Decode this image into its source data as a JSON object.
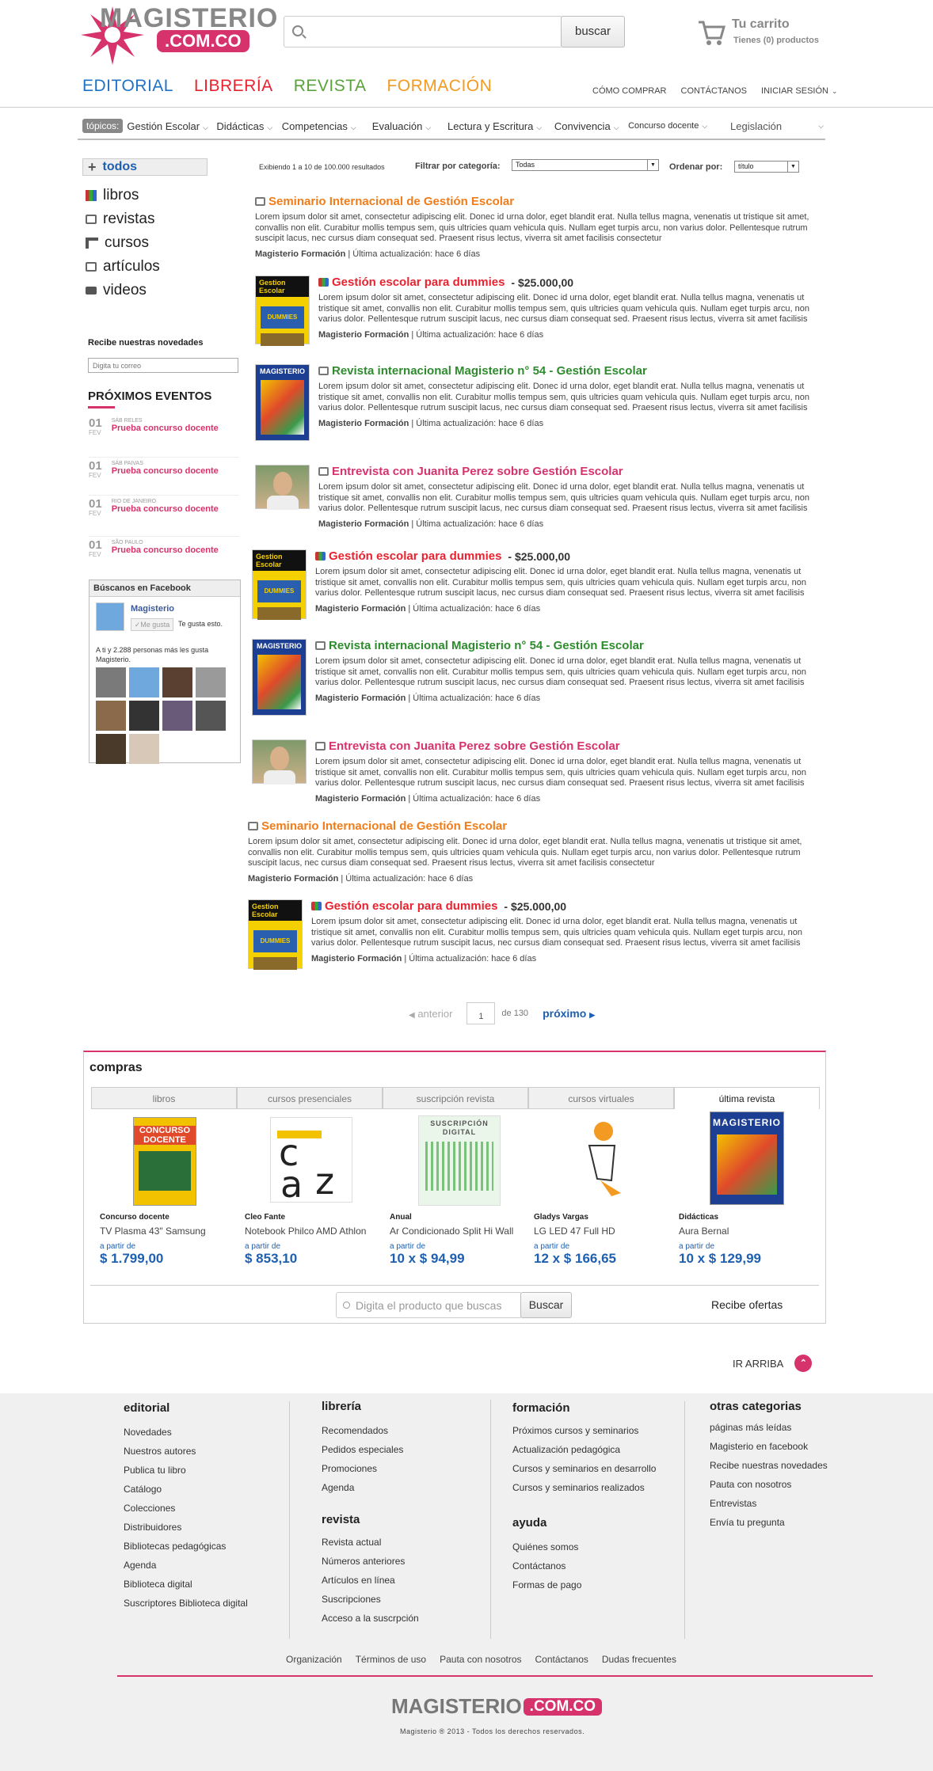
{
  "header": {
    "logo_word": "MAGISTERIO",
    "logo_suffix": ".COM.CO",
    "search_button": "buscar",
    "cart_title": "Tu carrito",
    "cart_sub": "Tienes (0) productos"
  },
  "main_nav": [
    "EDITORIAL",
    "LIBRERÍA",
    "REVISTA",
    "FORMACIÓN"
  ],
  "top_links": [
    "CÓMO COMPRAR",
    "CONTÁCTANOS",
    "INICIAR SESIÓN"
  ],
  "topics": {
    "label": "tópicos:",
    "items": [
      "Gestión Escolar",
      "Didácticas",
      "Competencias",
      "Evaluación",
      "Lectura y Escritura",
      "Convivencia",
      "Concurso docente",
      "Legislación"
    ]
  },
  "sidebar": {
    "all_label": "todos",
    "categories": [
      "libros",
      "revistas",
      "cursos",
      "artículos",
      "videos"
    ],
    "newsletter_title": "Recibe nuestras novedades",
    "newsletter_placeholder": "Digita tu correo",
    "events_title": "PRÓXIMOS EVENTOS",
    "events": [
      {
        "day": "01",
        "mon": "FEV",
        "sub": "SÁB RELES",
        "title": "Prueba concurso docente"
      },
      {
        "day": "01",
        "mon": "FEV",
        "sub": "SÁB PAIVAS",
        "title": "Prueba concurso docente"
      },
      {
        "day": "01",
        "mon": "FEV",
        "sub": "RIO DE JANEIRO",
        "title": "Prueba concurso docente"
      },
      {
        "day": "01",
        "mon": "FEV",
        "sub": "SÃO PAULO",
        "title": "Prueba concurso docente"
      }
    ],
    "fb_title": "Búscanos en Facebook",
    "fb_page": "Magisterio",
    "fb_like": "Me gusta",
    "fb_like_text": "Te gusta esto.",
    "fb_count": "A ti y 2.288 personas más les gusta Magisterio."
  },
  "results": {
    "summary": "Exibiendo 1 a 10 de 100.000 resultados",
    "filter_label": "Filtrar por categoría:",
    "filter_value": "Todas",
    "order_label": "Ordenar por:",
    "order_value": "título",
    "lorem": "Lorem ipsum dolor sit amet, consectetur adipiscing elit. Donec id urna dolor, eget blandit erat. Nulla tellus magna, venenatis ut tristique sit amet, convallis non elit. Curabitur mollis tempus sem, quis ultricies quam vehicula quis. Nullam eget turpis arcu, non varius dolor. Pellentesque rutrum suscipit lacus, nec cursus diam consequat sed. Praesent risus lectus, viverra sit amet facilisis consectetur",
    "meta_author": "Magisterio Formación",
    "meta_rest": "| Última actualización: hace 6 días",
    "items": [
      {
        "title": "Seminario Internacional de Gestión Escolar",
        "color": "#f07d1a",
        "price": "",
        "thumb": "none"
      },
      {
        "title": "Gestión escolar para dummies",
        "color": "#e8222f",
        "price": "- $25.000,00",
        "thumb": "dummies"
      },
      {
        "title": "Revista internacional Magisterio n° 54 - Gestión Escolar",
        "color": "#2e8b2e",
        "price": "",
        "thumb": "magazine"
      },
      {
        "title": "Entrevista con Juanita Perez sobre Gestión Escolar",
        "color": "#d6336c",
        "price": "",
        "thumb": "photo"
      },
      {
        "title": "Gestión escolar para dummies",
        "color": "#e8222f",
        "price": "- $25.000,00",
        "thumb": "dummies"
      },
      {
        "title": "Revista internacional Magisterio n° 54 - Gestión Escolar",
        "color": "#2e8b2e",
        "price": "",
        "thumb": "magazine"
      },
      {
        "title": "Entrevista con Juanita Perez sobre Gestión Escolar",
        "color": "#d6336c",
        "price": "",
        "thumb": "photo"
      },
      {
        "title": "Seminario Internacional de Gestión Escolar",
        "color": "#f07d1a",
        "price": "",
        "thumb": "none"
      },
      {
        "title": "Gestión escolar para dummies",
        "color": "#e8222f",
        "price": "- $25.000,00",
        "thumb": "dummies"
      }
    ]
  },
  "pagination": {
    "prev": "anterior",
    "page": "1",
    "of": "de 130",
    "next": "próximo"
  },
  "compras": {
    "title": "compras",
    "tabs": [
      "libros",
      "cursos presenciales",
      "suscripción revista",
      "cursos virtuales",
      "última revista"
    ],
    "products": [
      {
        "cat": "Concurso docente",
        "name": "TV Plasma 43\" Samsung",
        "apartir": "a partir de",
        "price": "$ 1.799,00"
      },
      {
        "cat": "Cleo Fante",
        "name": "Notebook Philco AMD Athlon",
        "apartir": "a partir de",
        "price": "$ 853,10"
      },
      {
        "cat": "Anual",
        "name": "Ar Condicionado Split Hi Wall",
        "apartir": "a partir de",
        "price": "10 x $ 94,99"
      },
      {
        "cat": "Gladys Vargas",
        "name": "LG LED 47 Full HD",
        "apartir": "a partir de",
        "price": "12 x $ 166,65"
      },
      {
        "cat": "Didácticas",
        "name": "Aura Bernal",
        "apartir": "a partir de",
        "price": "10 x $ 129,99"
      }
    ],
    "search_placeholder": "Digita el producto que buscas",
    "search_button": "Buscar",
    "offers": "Recibe ofertas"
  },
  "back_to_top": "IR ARRIBA",
  "footer": {
    "cols": [
      {
        "title": "editorial",
        "links": [
          "Novedades",
          "Nuestros autores",
          "Publica tu libro",
          "Catálogo",
          "Colecciones",
          "Distribuidores",
          "Bibliotecas pedagógicas",
          "Agenda",
          "Biblioteca digital",
          "Suscriptores Biblioteca digital"
        ]
      },
      {
        "title": "librería",
        "links": [
          "Recomendados",
          "Pedidos especiales",
          "Promociones",
          "Agenda"
        ],
        "title2": "revista",
        "links2": [
          "Revista actual",
          "Números anteriores",
          "Artículos en línea",
          "Suscripciones",
          "Acceso a la suscrpción"
        ]
      },
      {
        "title": "formación",
        "links": [
          "Próximos cursos y seminarios",
          "Actualización pedagógica",
          "Cursos y seminarios en desarrollo",
          "Cursos y seminarios realizados"
        ],
        "title2": "ayuda",
        "links2": [
          "Quiénes somos",
          "Contáctanos",
          "Formas de pago"
        ]
      },
      {
        "title": "otras categorias",
        "links": [
          "páginas más leídas",
          "Magisterio en facebook",
          "Recibe nuestras novedades",
          "Pauta con nosotros",
          "Entrevistas",
          "Envía tu pregunta"
        ]
      }
    ],
    "bottom_links": [
      "Organización",
      "Términos de uso",
      "Pauta con nosotros",
      "Contáctanos",
      "Dudas frecuentes"
    ],
    "copyright": "Magisterio ® 2013 - Todos los derechos reservados."
  }
}
